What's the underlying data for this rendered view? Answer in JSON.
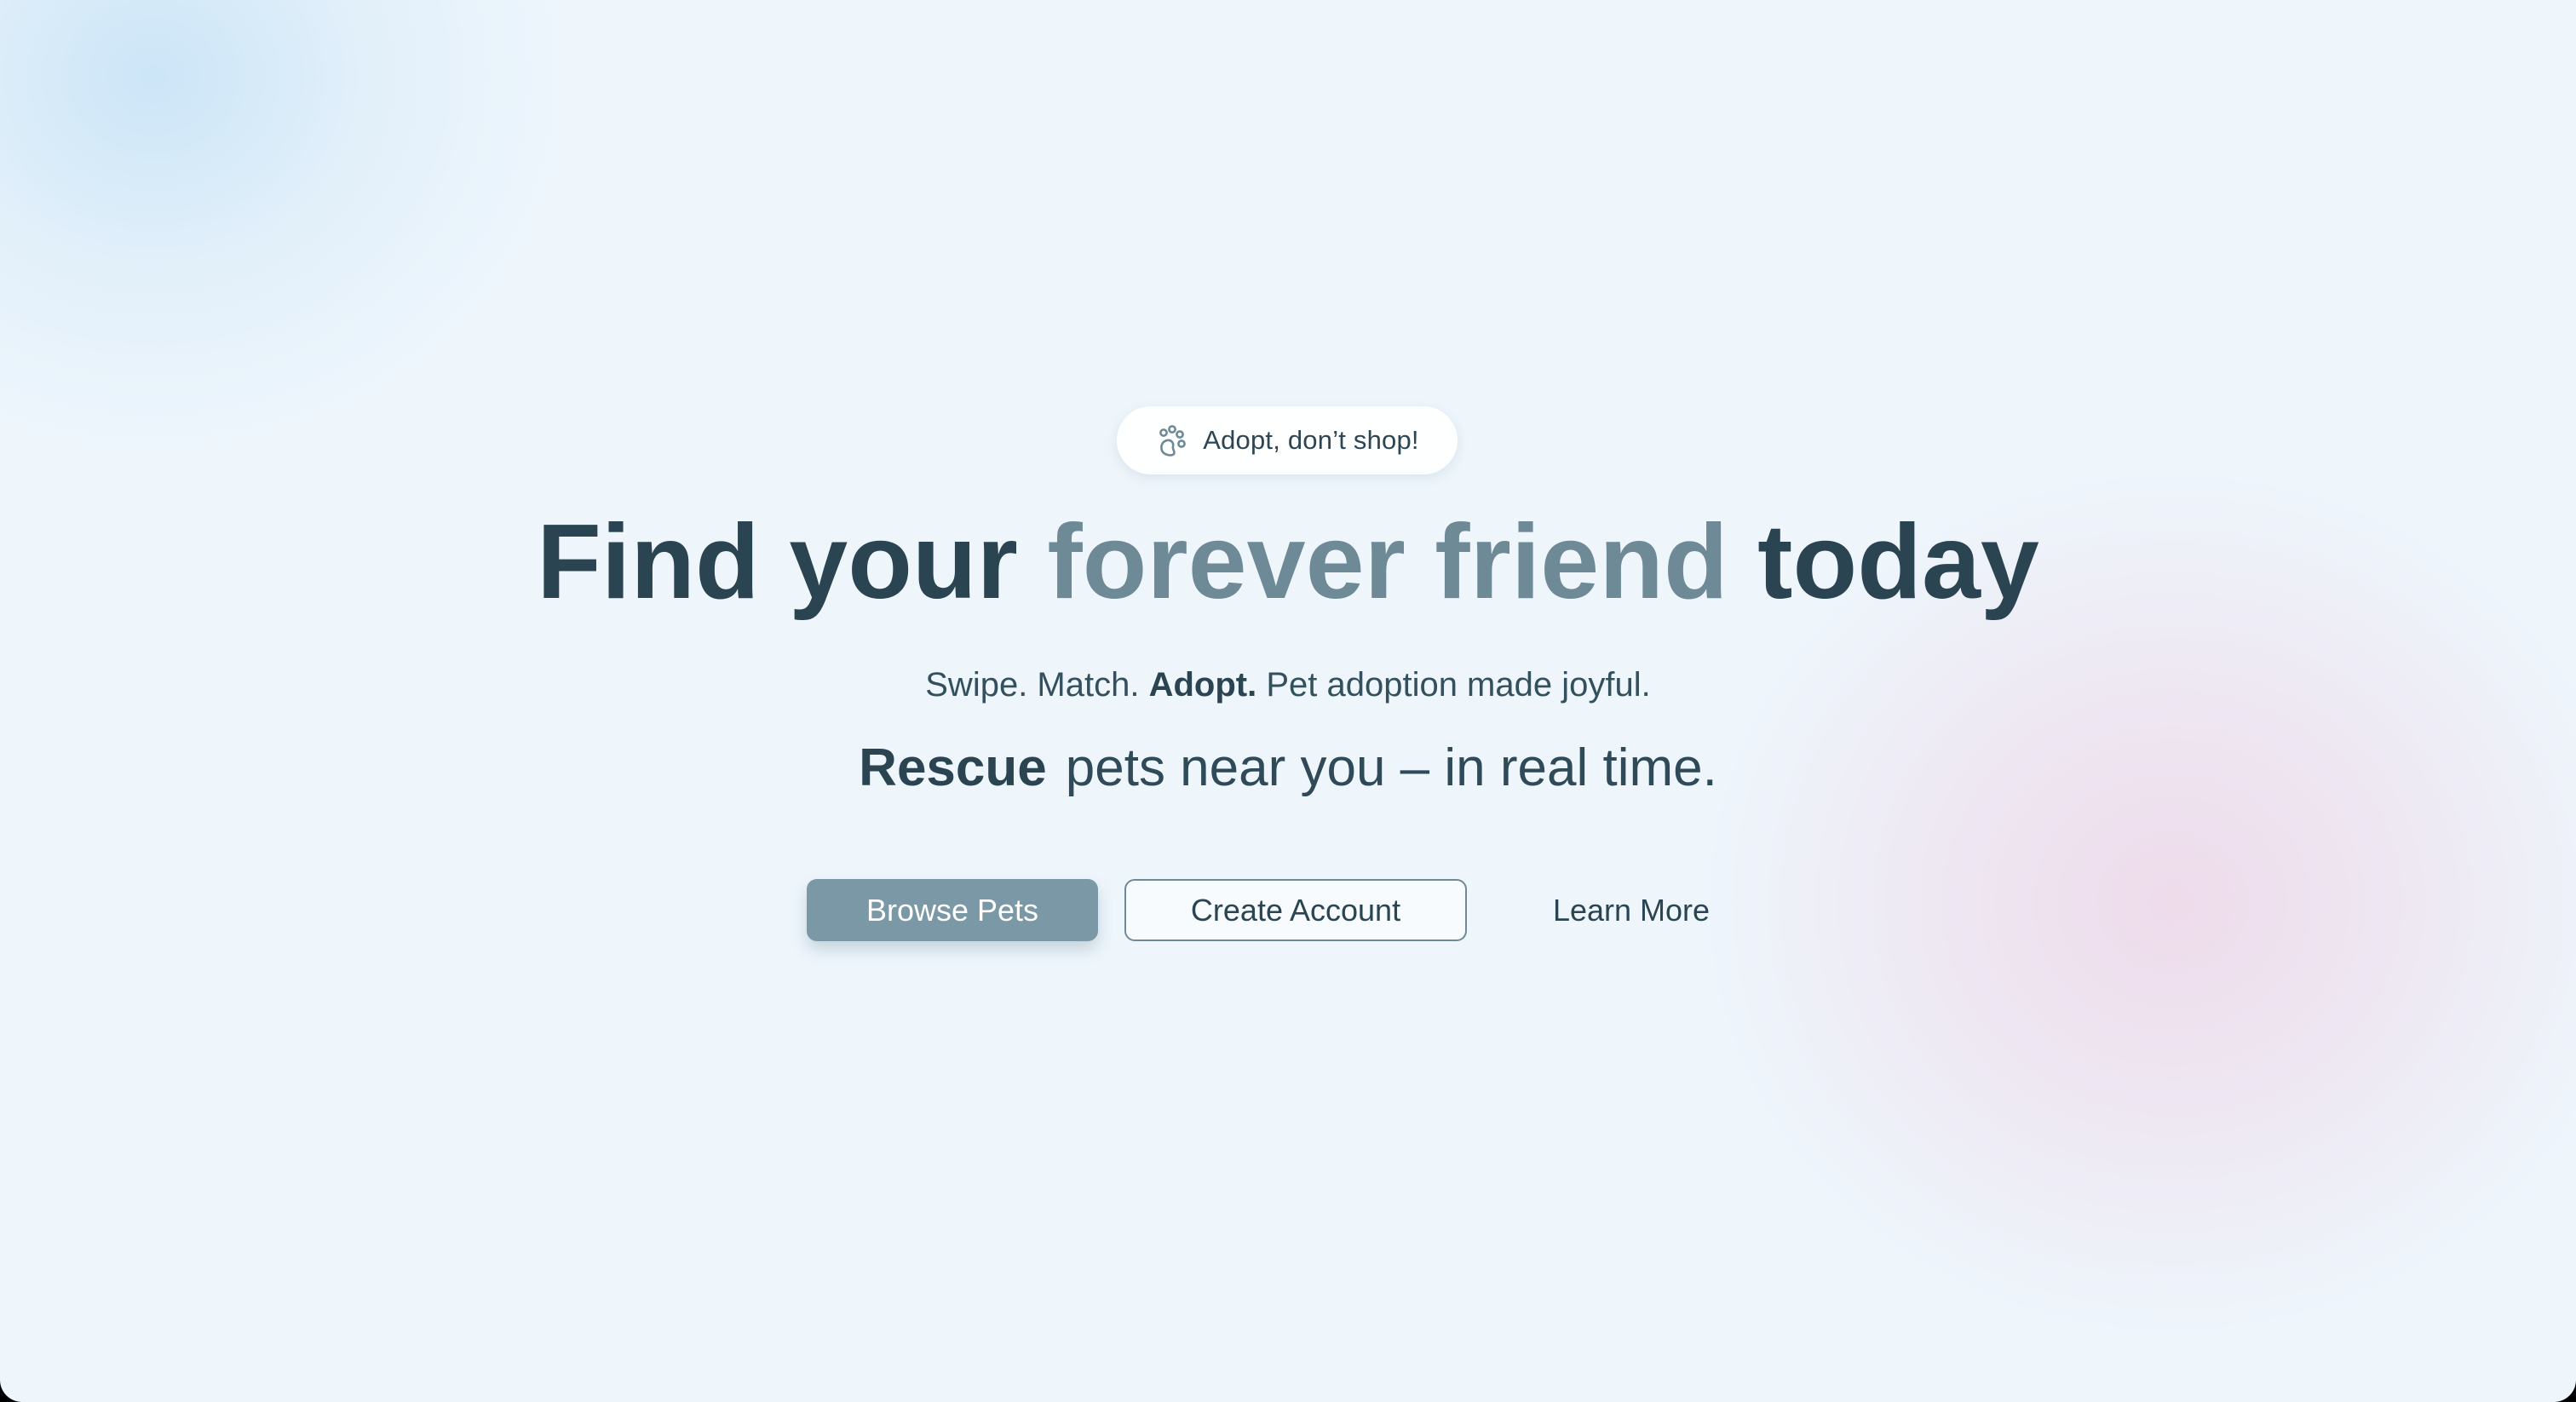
{
  "badge": {
    "icon": "paw-icon",
    "text": "Adopt, don’t shop!"
  },
  "headline": {
    "part1": "Find your ",
    "accent": "forever friend",
    "part2": " today",
    "accent_color": "#6e8a96",
    "text_color": "#2b4451"
  },
  "tagline": {
    "part1": "Swipe. Match. ",
    "bold": "Adopt.",
    "part2": " Pet adoption made joyful."
  },
  "rescue_line": {
    "rotating_word": "Rescue",
    "rest": "pets near you – in real time."
  },
  "buttons": {
    "browse": "Browse Pets",
    "create_account": "Create Account",
    "learn_more": "Learn More"
  },
  "colors": {
    "primary_button": "#7a98a6",
    "background": "#eef6fc"
  }
}
